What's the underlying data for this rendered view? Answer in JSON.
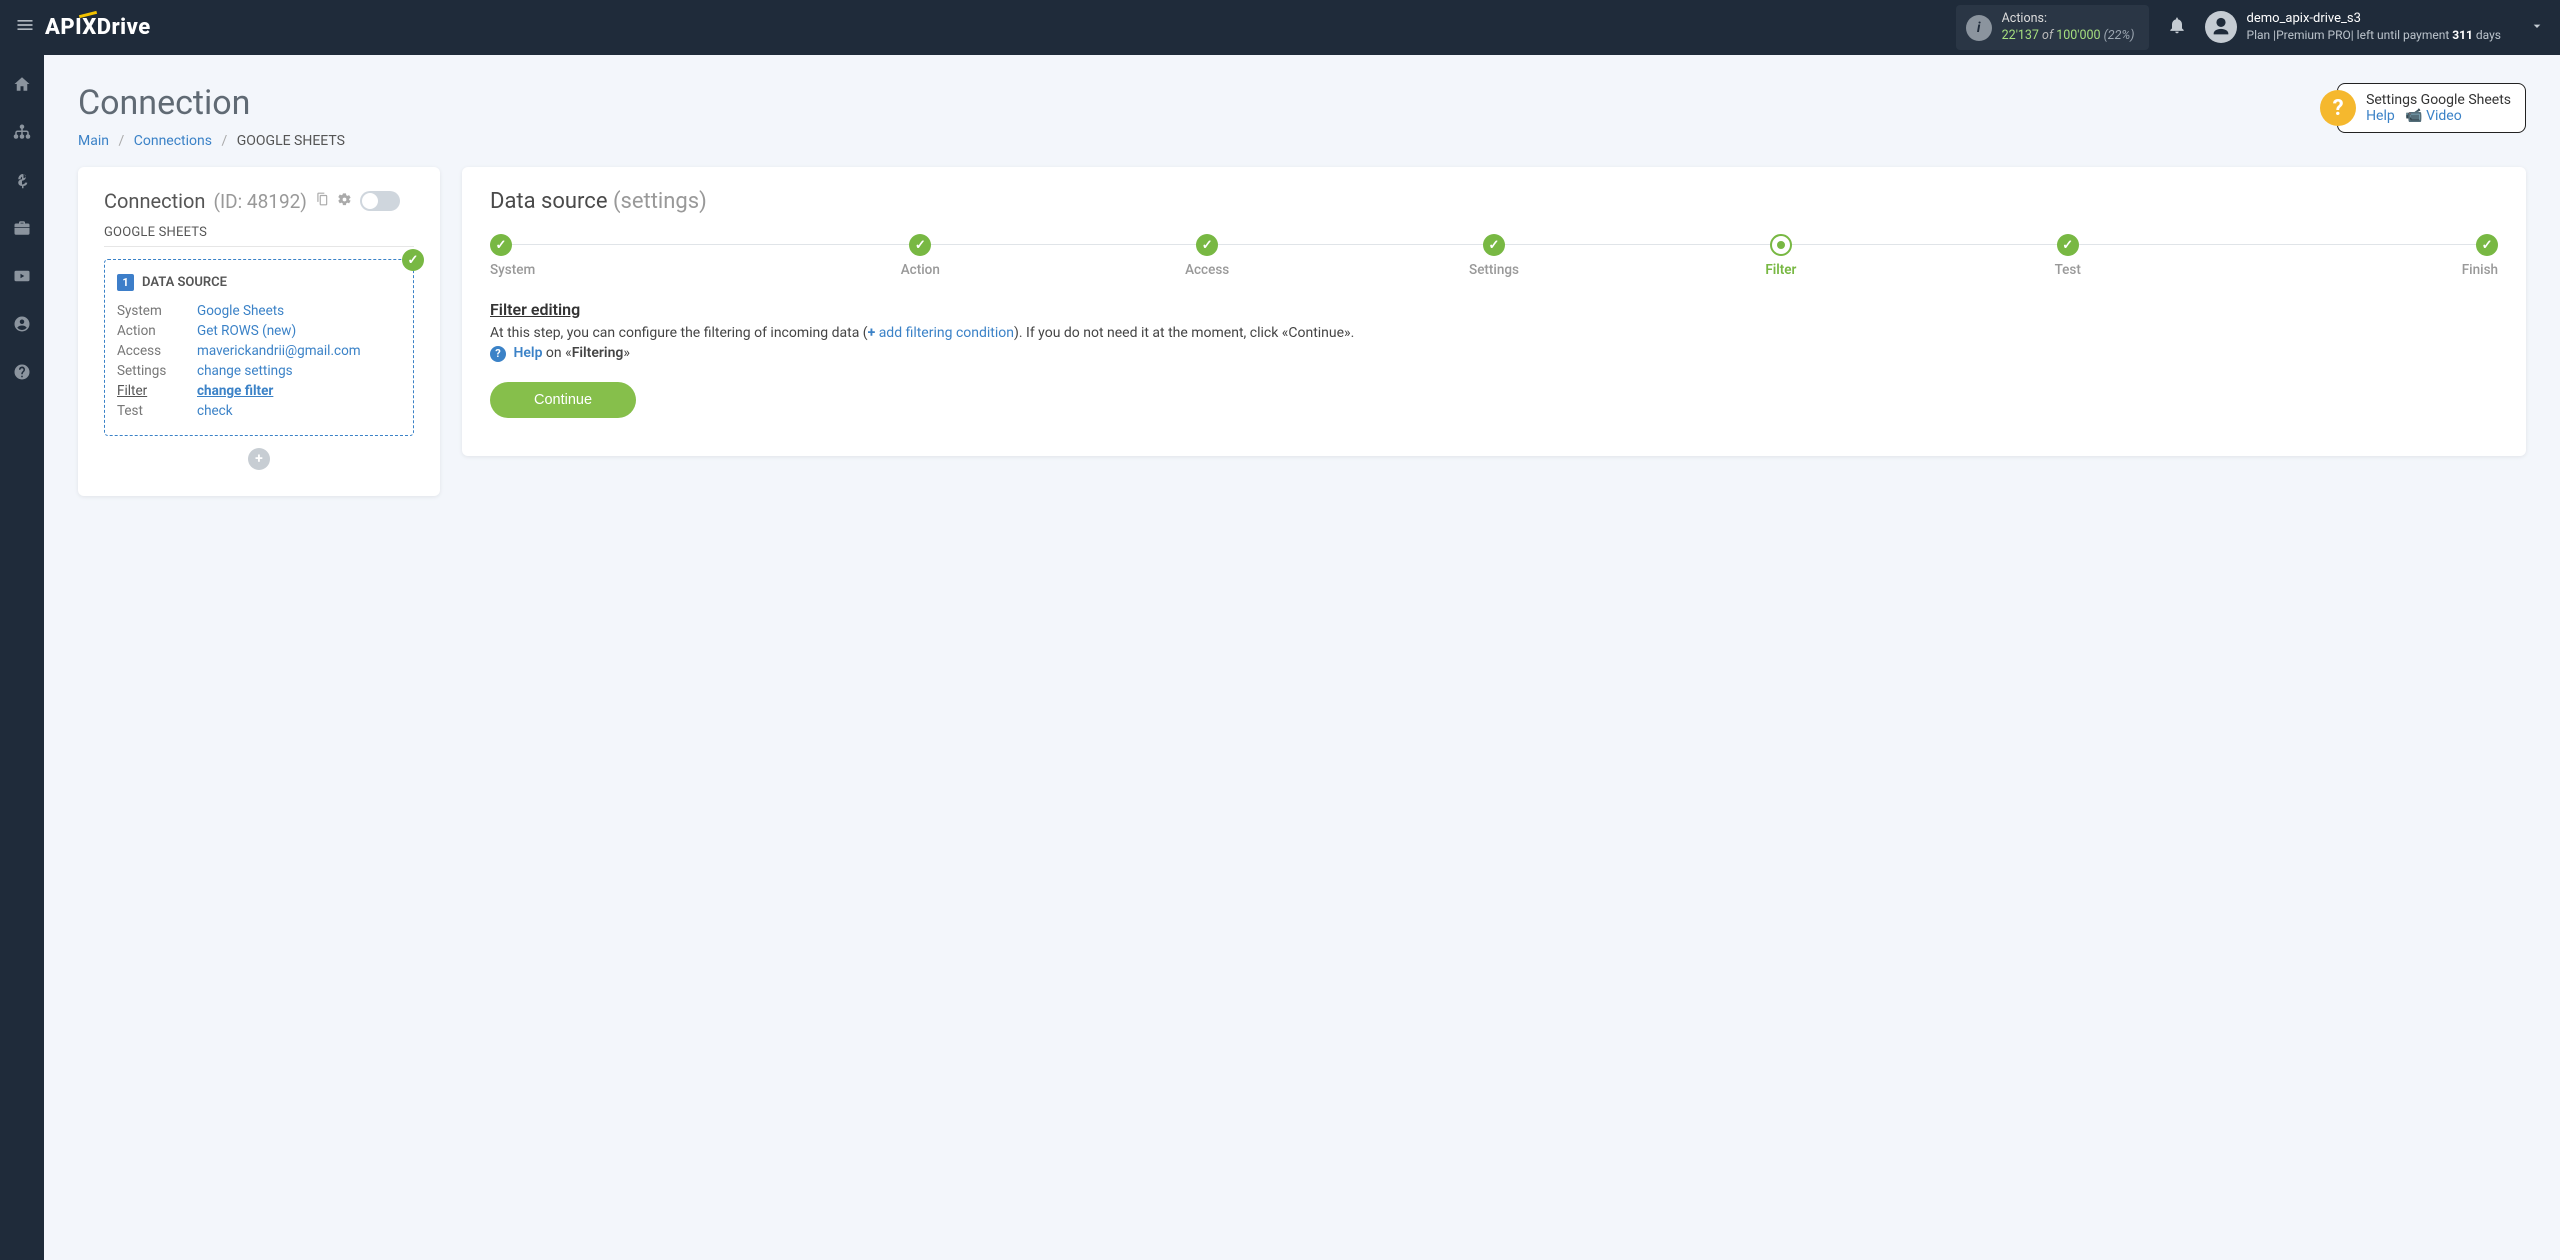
{
  "header": {
    "logo_1": "API",
    "logo_x": "X",
    "logo_2": "Drive",
    "actions_label": "Actions:",
    "actions_used": "22'137",
    "actions_of": " of ",
    "actions_total": "100'000",
    "actions_pct": " (22%)",
    "user_name": "demo_apix-drive_s3",
    "plan_prefix": "Plan ",
    "plan_name": "|Premium PRO|",
    "plan_mid": " left until payment ",
    "plan_days": "311",
    "plan_suffix": " days"
  },
  "page": {
    "title": "Connection",
    "bc_main": "Main",
    "bc_connections": "Connections",
    "bc_current": "GOOGLE SHEETS",
    "help_title": "Settings Google Sheets",
    "help_link": "Help",
    "video_link": "Video"
  },
  "left_card": {
    "title": "Connection",
    "id_label": "(ID: 48192)",
    "subhead": "GOOGLE SHEETS",
    "ds_number": "1",
    "ds_title": "DATA SOURCE",
    "rows": [
      {
        "label": "System",
        "value": "Google Sheets",
        "active": false
      },
      {
        "label": "Action",
        "value": "Get ROWS (new)",
        "active": false
      },
      {
        "label": "Access",
        "value": "maverickandrii@gmail.com",
        "active": false
      },
      {
        "label": "Settings",
        "value": "change settings",
        "active": false
      },
      {
        "label": "Filter",
        "value": "change filter",
        "active": true
      },
      {
        "label": "Test",
        "value": "check",
        "active": false
      }
    ]
  },
  "right_card": {
    "title": "Data source",
    "title_sub": "(settings)",
    "steps": [
      {
        "label": "System",
        "state": "done"
      },
      {
        "label": "Action",
        "state": "done"
      },
      {
        "label": "Access",
        "state": "done"
      },
      {
        "label": "Settings",
        "state": "done"
      },
      {
        "label": "Filter",
        "state": "current"
      },
      {
        "label": "Test",
        "state": "done"
      },
      {
        "label": "Finish",
        "state": "done"
      }
    ],
    "section_title": "Filter editing",
    "desc_1": "At this step, you can configure the filtering of incoming data (",
    "desc_add": "add filtering condition",
    "desc_2": "). If you do not need it at the moment, click «Continue».",
    "help_word": "Help",
    "help_on": " on «",
    "help_topic": "Filtering",
    "help_close": "»",
    "continue": "Continue"
  }
}
